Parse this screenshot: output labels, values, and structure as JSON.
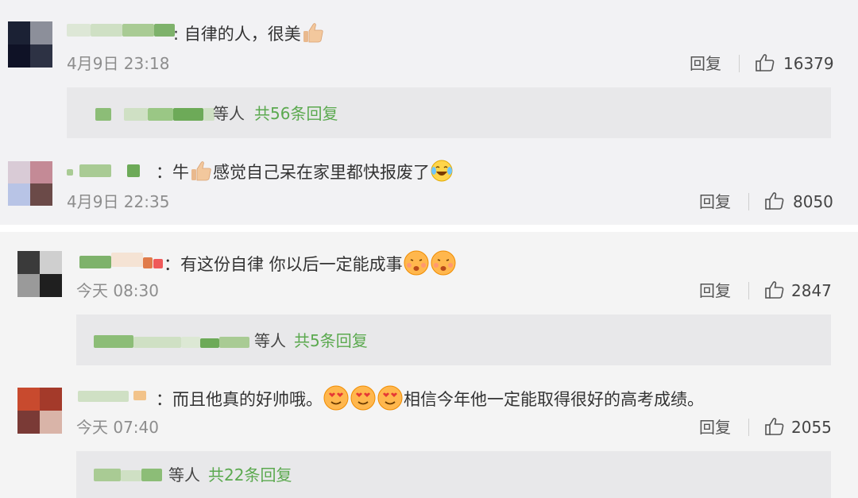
{
  "comments": [
    {
      "text": ":  自律的人，很美",
      "time": "4月9日 23:18",
      "reply_label": "回复",
      "likes": "16379",
      "sub": {
        "suffix": "等人",
        "count_label": "共56条回复"
      },
      "emoji": "thumbs-up-icon"
    },
    {
      "text_a": "：牛",
      "text_b": "感觉自己呆在家里都快报废了",
      "time": "4月9日 22:35",
      "reply_label": "回复",
      "likes": "8050",
      "emoji": [
        "thumbs-up-icon",
        "laugh-crying-icon"
      ]
    },
    {
      "text": "：有这份自律   你以后一定能成事",
      "time": "今天 08:30",
      "reply_label": "回复",
      "likes": "2847",
      "sub": {
        "suffix": "等人",
        "count_label": "共5条回复"
      },
      "emoji": [
        "kiss-face-icon",
        "kiss-face-icon"
      ]
    },
    {
      "text_a": "：而且他真的好帅哦。",
      "text_b": "相信今年他一定能取得很好的高考成绩。",
      "time": "今天 07:40",
      "reply_label": "回复",
      "likes": "2055",
      "sub": {
        "suffix": "等人",
        "count_label": "共22条回复"
      },
      "emoji": [
        "heart-eyes-icon",
        "heart-eyes-icon",
        "heart-eyes-icon"
      ]
    }
  ],
  "colors": {
    "link_green": "#5ba94f",
    "muted": "#8d8d8d",
    "panel_bg": "#f2f2f4",
    "subbox_bg": "#e8e8ea"
  }
}
